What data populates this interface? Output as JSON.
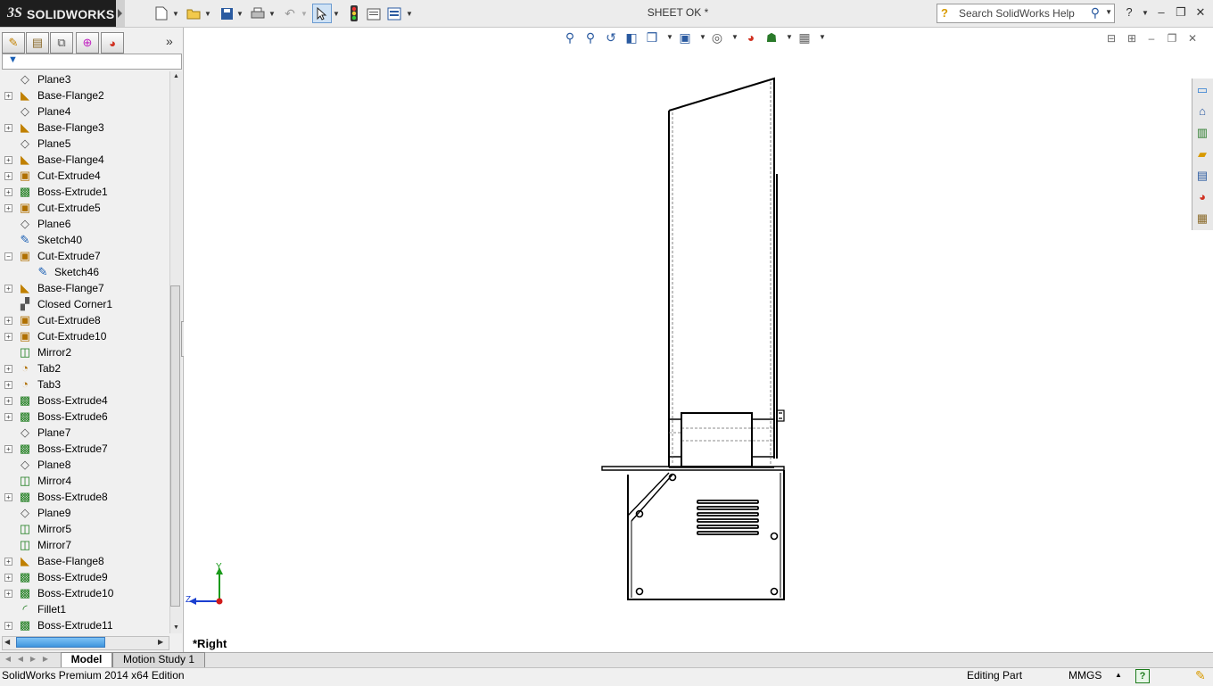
{
  "app": {
    "brand": "SOLIDWORKS",
    "document_title": "SHEET OK *"
  },
  "toolbar": {
    "icons": [
      "new-document-icon",
      "open-icon",
      "save-icon",
      "print-icon",
      "undo-icon",
      "select-icon",
      "rebuild-icon",
      "file-properties-icon",
      "options-icon"
    ]
  },
  "search": {
    "placeholder": "Search SolidWorks Help"
  },
  "feature_tree": {
    "items": [
      {
        "label": "Plane3",
        "icon": "plane-icon",
        "expander": false
      },
      {
        "label": "Base-Flange2",
        "icon": "base-flange-icon",
        "expander": true
      },
      {
        "label": "Plane4",
        "icon": "plane-icon",
        "expander": false
      },
      {
        "label": "Base-Flange3",
        "icon": "base-flange-icon",
        "expander": true
      },
      {
        "label": "Plane5",
        "icon": "plane-icon",
        "expander": false
      },
      {
        "label": "Base-Flange4",
        "icon": "base-flange-icon",
        "expander": true
      },
      {
        "label": "Cut-Extrude4",
        "icon": "cut-extrude-icon",
        "expander": true
      },
      {
        "label": "Boss-Extrude1",
        "icon": "boss-extrude-icon",
        "expander": true
      },
      {
        "label": "Cut-Extrude5",
        "icon": "cut-extrude-icon",
        "expander": true
      },
      {
        "label": "Plane6",
        "icon": "plane-icon",
        "expander": false
      },
      {
        "label": "Sketch40",
        "icon": "sketch-icon",
        "expander": false
      },
      {
        "label": "Cut-Extrude7",
        "icon": "cut-extrude-icon",
        "expander": true,
        "expanded": true
      },
      {
        "label": "Sketch46",
        "icon": "sketch-icon",
        "expander": false,
        "child": true
      },
      {
        "label": "Base-Flange7",
        "icon": "base-flange-icon",
        "expander": true
      },
      {
        "label": "Closed Corner1",
        "icon": "closed-corner-icon",
        "expander": false
      },
      {
        "label": "Cut-Extrude8",
        "icon": "cut-extrude-icon",
        "expander": true
      },
      {
        "label": "Cut-Extrude10",
        "icon": "cut-extrude-icon",
        "expander": true
      },
      {
        "label": "Mirror2",
        "icon": "mirror-icon",
        "expander": false
      },
      {
        "label": "Tab2",
        "icon": "tab-icon",
        "expander": true
      },
      {
        "label": "Tab3",
        "icon": "tab-icon",
        "expander": true
      },
      {
        "label": "Boss-Extrude4",
        "icon": "boss-extrude-icon",
        "expander": true
      },
      {
        "label": "Boss-Extrude6",
        "icon": "boss-extrude-icon",
        "expander": true
      },
      {
        "label": "Plane7",
        "icon": "plane-icon",
        "expander": false
      },
      {
        "label": "Boss-Extrude7",
        "icon": "boss-extrude-icon",
        "expander": true
      },
      {
        "label": "Plane8",
        "icon": "plane-icon",
        "expander": false
      },
      {
        "label": "Mirror4",
        "icon": "mirror-icon",
        "expander": false
      },
      {
        "label": "Boss-Extrude8",
        "icon": "boss-extrude-icon",
        "expander": true
      },
      {
        "label": "Plane9",
        "icon": "plane-icon",
        "expander": false
      },
      {
        "label": "Mirror5",
        "icon": "mirror-icon",
        "expander": false
      },
      {
        "label": "Mirror7",
        "icon": "mirror-icon",
        "expander": false
      },
      {
        "label": "Base-Flange8",
        "icon": "base-flange-icon",
        "expander": true
      },
      {
        "label": "Boss-Extrude9",
        "icon": "boss-extrude-icon",
        "expander": true
      },
      {
        "label": "Boss-Extrude10",
        "icon": "boss-extrude-icon",
        "expander": true
      },
      {
        "label": "Fillet1",
        "icon": "fillet-icon",
        "expander": false
      },
      {
        "label": "Boss-Extrude11",
        "icon": "boss-extrude-icon",
        "expander": true
      }
    ]
  },
  "viewport": {
    "view_name": "*Right",
    "triad": {
      "y_label": "Y",
      "z_label": "Z"
    }
  },
  "bottom_tabs": [
    {
      "label": "Model",
      "active": true
    },
    {
      "label": "Motion Study 1",
      "active": false
    }
  ],
  "status_bar": {
    "edition": "SolidWorks Premium 2014 x64 Edition",
    "mode": "Editing Part",
    "units": "MMGS",
    "help": "?"
  },
  "colors": {
    "brand_bar": "#1e1e1e",
    "axis_y": "#1a9a1a",
    "axis_z": "#1a3fd0",
    "origin": "#d01a1a"
  }
}
